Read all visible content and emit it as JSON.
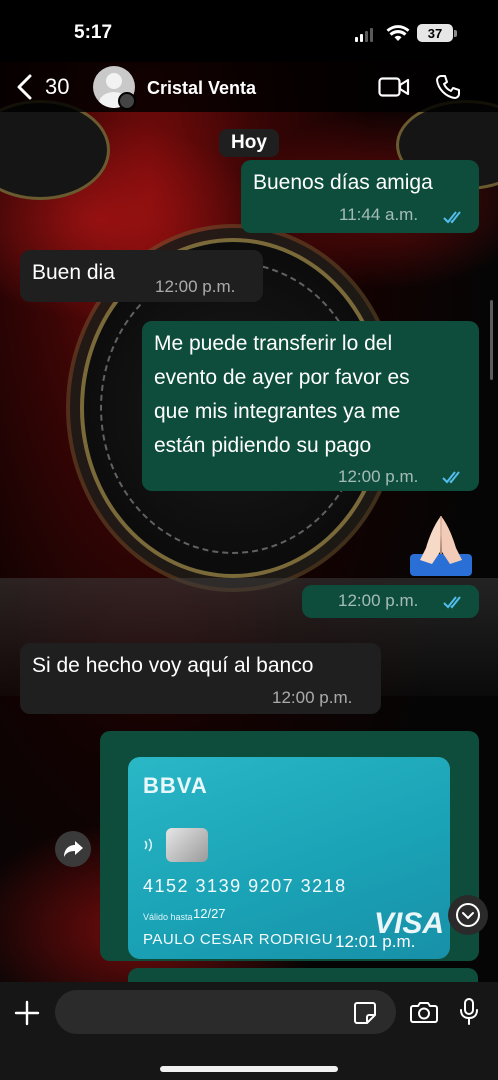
{
  "status_bar": {
    "time": "5:17",
    "battery": "37",
    "signal_bars": 2
  },
  "header": {
    "back_count": "30",
    "contact_name": "Cristal Venta",
    "icons": [
      "chevron-left-icon",
      "avatar-icon",
      "video-icon",
      "phone-icon"
    ]
  },
  "chat": {
    "date_chip": "Hoy",
    "messages": [
      {
        "direction": "outgoing",
        "text": "Buenos días amiga",
        "time": "11:44 a.m.",
        "status": "read"
      },
      {
        "direction": "incoming",
        "text": "Buen dia",
        "time": "12:00 p.m."
      },
      {
        "direction": "outgoing",
        "lines": [
          "Me puede transferir lo del",
          "evento de ayer por favor es",
          "que mis integrantes ya me",
          "están pidiendo su pago"
        ],
        "time": "12:00 p.m.",
        "status": "read"
      },
      {
        "direction": "outgoing",
        "emoji": "🙏🏻",
        "time": "12:00 p.m.",
        "status": "read"
      },
      {
        "direction": "incoming",
        "text": "Si de hecho voy aquí al banco",
        "time": "12:00 p.m."
      },
      {
        "direction": "outgoing",
        "type": "image",
        "time": "12:01 p.m.",
        "card": {
          "brand": "BBVA",
          "number": "4152 3139 9207 3218",
          "valid_label": "Válido hasta",
          "valid_date": "12/27",
          "holder": "PAULO CESAR RODRIGU",
          "network": "VISA"
        }
      }
    ]
  },
  "input_bar": {
    "placeholder": "",
    "icons": [
      "plus-icon",
      "sticker-icon",
      "camera-icon",
      "mic-icon"
    ]
  },
  "colors": {
    "outgoing_bubble": "#0e4d3c",
    "incoming_bubble": "#1f1f1f",
    "read_ticks": "#53bdeb",
    "card": "#1aa3b6"
  }
}
